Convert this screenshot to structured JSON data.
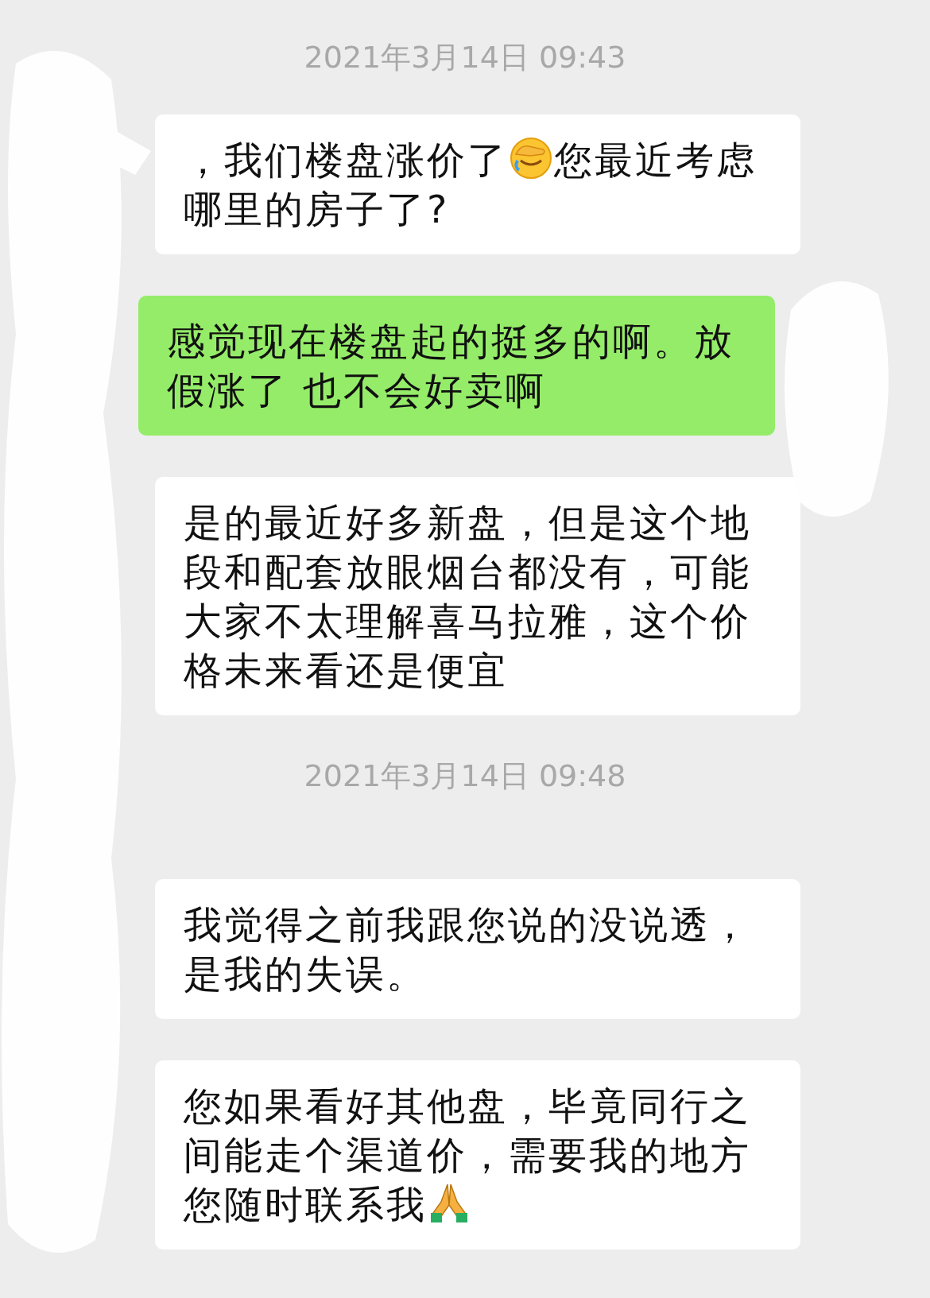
{
  "messages": [
    {
      "kind": "timestamp",
      "text": "2021年3月14日 09:43"
    },
    {
      "kind": "incoming",
      "parts": [
        {
          "kind": "text",
          "text": "，我们楼盘涨价了"
        },
        {
          "kind": "facepalm"
        },
        {
          "kind": "text",
          "text": "您最近考虑哪里的房子了?"
        }
      ]
    },
    {
      "kind": "outgoing",
      "parts": [
        {
          "kind": "text",
          "text": "感觉现在楼盘起的挺多的啊。放假涨了 也不会好卖啊"
        }
      ]
    },
    {
      "kind": "incoming",
      "parts": [
        {
          "kind": "text",
          "text": "是的最近好多新盘，但是这个地段和配套放眼烟台都没有，可能大家不太理解喜马拉雅，这个价格未来看还是便宜"
        }
      ]
    },
    {
      "kind": "timestamp",
      "text": "2021年3月14日 09:48"
    },
    {
      "kind": "incoming",
      "parts": [
        {
          "kind": "text",
          "text": "我觉得之前我跟您说的没说透，是我的失误。"
        }
      ]
    },
    {
      "kind": "incoming",
      "parts": [
        {
          "kind": "text",
          "text": "您如果看好其他盘，毕竟同行之间能走个渠道价，需要我的地方您随时联系我"
        },
        {
          "kind": "pray"
        }
      ]
    }
  ]
}
